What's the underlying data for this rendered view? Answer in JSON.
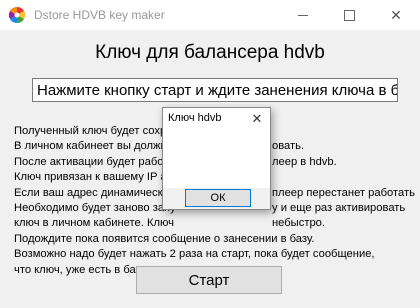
{
  "window": {
    "title": "Dstore HDVB key maker",
    "icon": "colorful-wheel-icon"
  },
  "main": {
    "heading": "Ключ для балансера hdvb",
    "status_value": "Нажмите кнопку старт и ждите заненения ключа в базу.",
    "info_lines": [
      "Полученный ключ будет сохра",
      "В личном кабинеет вы должны",
      "После активации будет работа",
      "Ключ привязан к вашему IP ад",
      "Если ваш адрес динамический",
      "Необходимо будет заново запу",
      "ключ в личном кабинете. Ключ",
      "Подождите пока появится сообщение о занесении в базу.",
      "Возможно надо будет нажать 2 раза на старт, пока будет сообщение,",
      "что ключ, уже есть в базе."
    ],
    "info_tails": [
      "",
      "овать.",
      "леер в hdvb.",
      "",
      "плеер перестанет работать",
      "у и еще раз активировать",
      "небыстро.",
      "",
      "",
      ""
    ],
    "start_label": "Старт"
  },
  "dialog": {
    "title": "Ключ hdvb",
    "close_glyph": "✕",
    "ok_label": "ОК"
  },
  "titlebar_buttons": {
    "close_glyph": "✕"
  }
}
